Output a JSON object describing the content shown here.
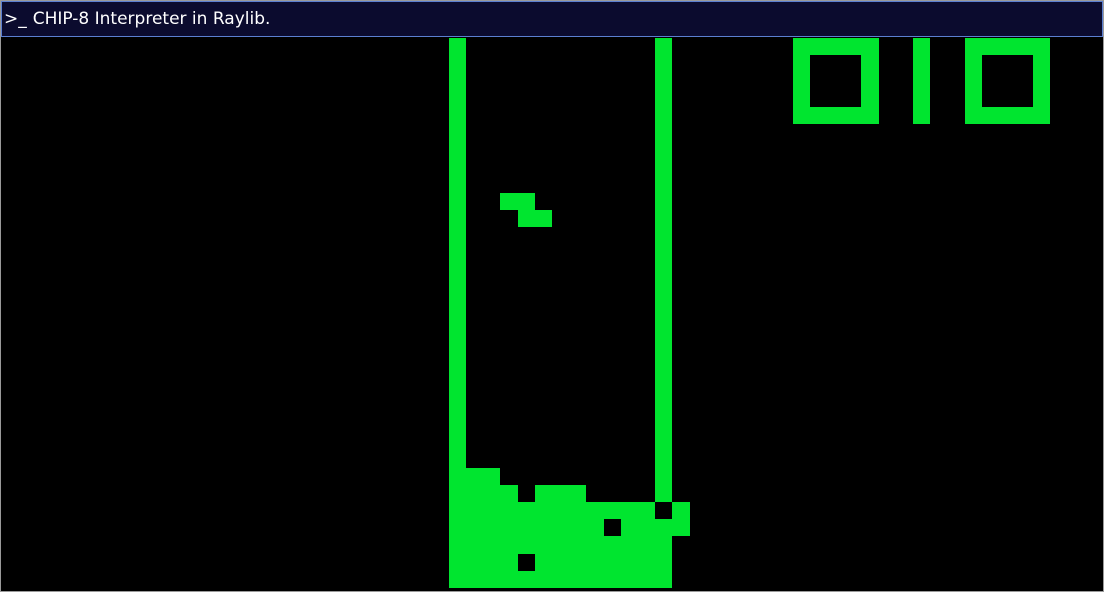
{
  "window": {
    "title_icon": ">_",
    "title": "CHIP-8 Interpreter in Raylib."
  },
  "display": {
    "resolution": "64x32",
    "foreground_color": "#00e52f",
    "background_color": "#000000",
    "score_digits": [
      "0",
      "1",
      "0"
    ],
    "rows": [
      "                          #           #       #####  #  #####",
      "                          #           #       #   #  #  #   #",
      "                          #           #       #   #  #  #   #",
      "                          #           #       #   #  #  #   #",
      "                          #           #       #####  #  #####",
      "                          #           #                      ",
      "                          #           #                      ",
      "                          #           #                      ",
      "                          #           #                      ",
      "                          #  ##       #                      ",
      "                          #   ##      #                      ",
      "                          #           #                      ",
      "                          #           #                      ",
      "                          #           #                      ",
      "                          #           #                      ",
      "                          #           #                      ",
      "                          #           #                      ",
      "                          #           #                      ",
      "                          #           #                      ",
      "                          #           #                      ",
      "                          #           #                      ",
      "                          #           #                      ",
      "                          #           #                      ",
      "                          #           #                      ",
      "                          #           #                      ",
      "                          ###         #                      ",
      "                          #### ###    #                      ",
      "                          ############ #                      ",
      "                          ######### ####                      ",
      "                          #############                      ",
      "                          #### ########                      ",
      "                          #############                      "
    ]
  }
}
